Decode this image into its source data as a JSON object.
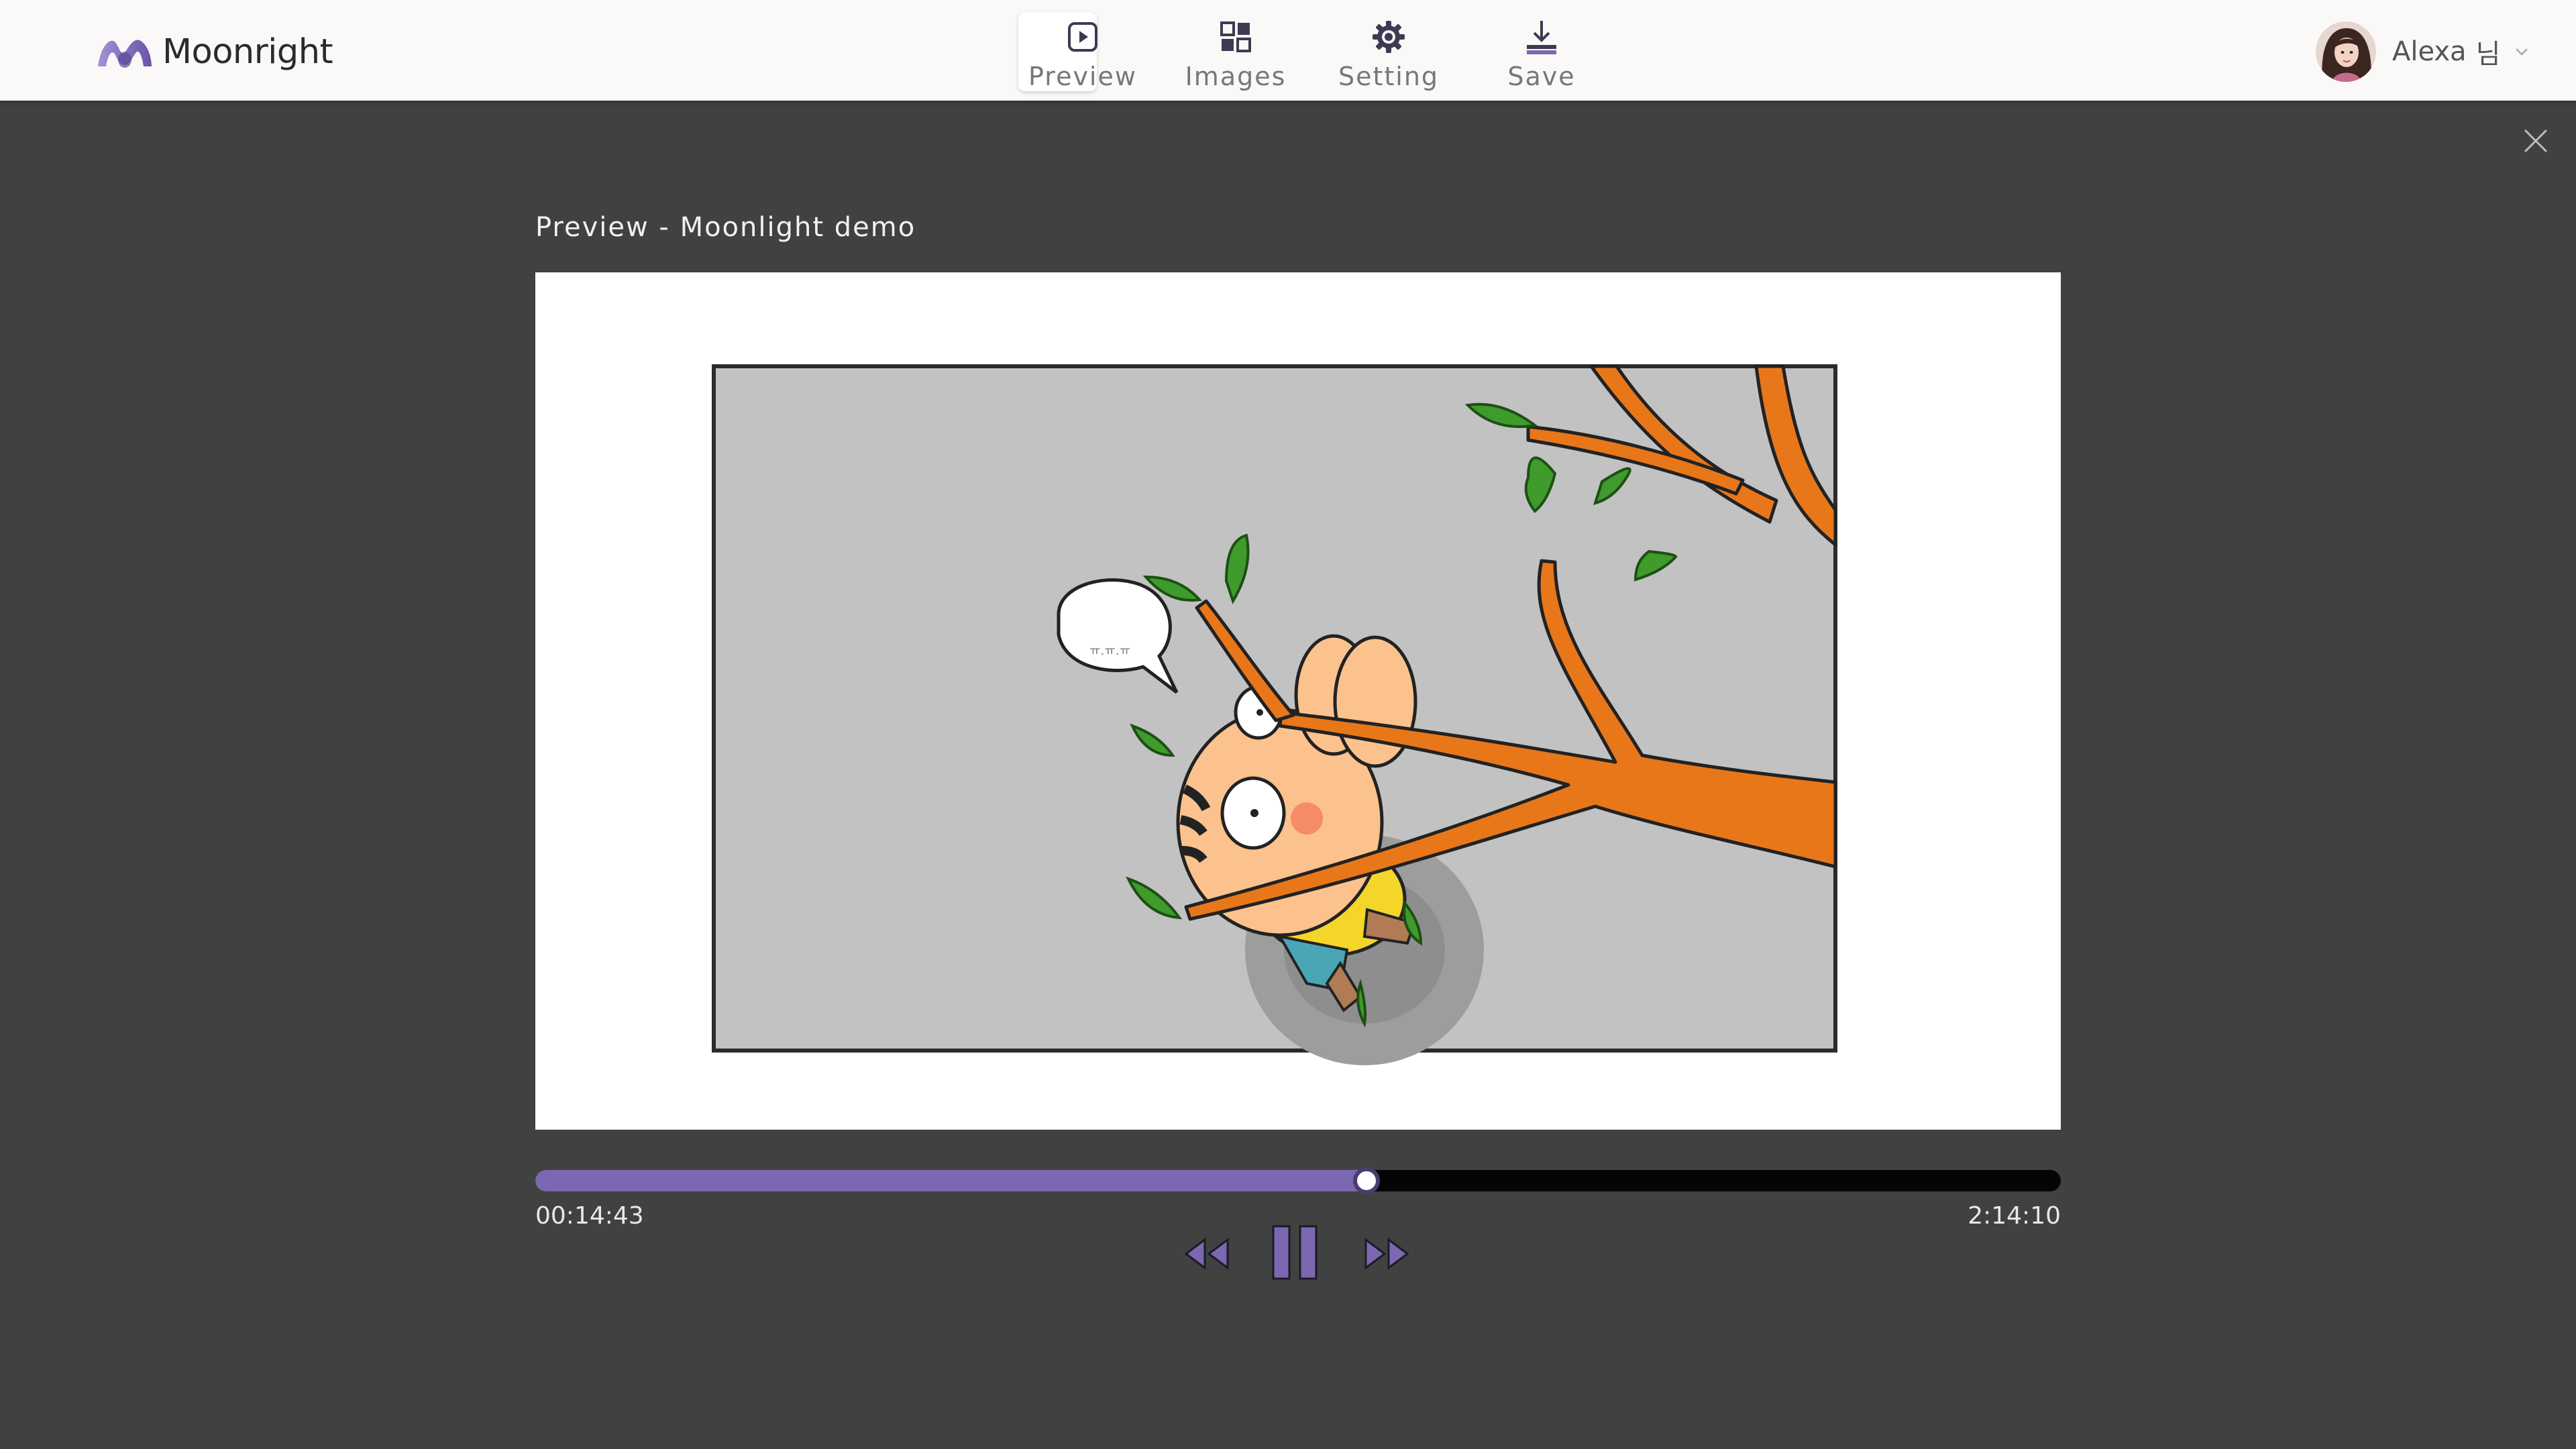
{
  "app": {
    "name": "Moonright",
    "brand_color": "#7b68b0"
  },
  "nav": {
    "items": [
      {
        "label": "Preview",
        "icon": "play-square-icon",
        "active": true
      },
      {
        "label": "Images",
        "icon": "grid-icon",
        "active": false
      },
      {
        "label": "Setting",
        "icon": "gear-icon",
        "active": false
      },
      {
        "label": "Save",
        "icon": "download-icon",
        "active": false
      }
    ]
  },
  "user": {
    "name": "Alexa",
    "suffix": "님"
  },
  "preview": {
    "title": "Preview - Moonlight demo",
    "speech_bubble_text": "ㅠ.ㅠ.ㅠ"
  },
  "player": {
    "current_time": "00:14:43",
    "total_time": "2:14:10",
    "progress_fraction": 0.545,
    "played_color": "#7b68b0",
    "track_color": "#050505",
    "state": "playing"
  },
  "icons": {
    "close": "close-icon",
    "rewind": "rewind-icon",
    "pause": "pause-icon",
    "fast_forward": "fast-forward-icon",
    "caret": "chevron-down-icon"
  }
}
